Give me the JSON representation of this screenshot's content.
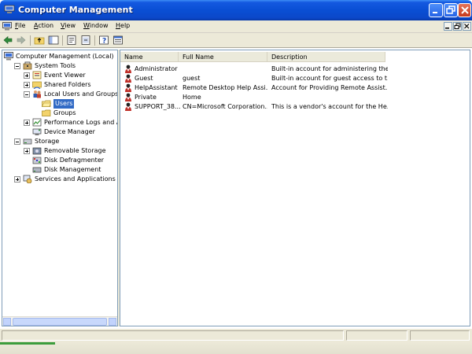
{
  "window": {
    "title": "Computer Management"
  },
  "menu": [
    "File",
    "Action",
    "View",
    "Window",
    "Help"
  ],
  "tree": [
    {
      "label": "Computer Management (Local)",
      "indent": 0,
      "expander": "none",
      "icon": "computer-icon"
    },
    {
      "label": "System Tools",
      "indent": 1,
      "expander": "minus",
      "icon": "tools-icon"
    },
    {
      "label": "Event Viewer",
      "indent": 2,
      "expander": "plus",
      "icon": "event-viewer-icon"
    },
    {
      "label": "Shared Folders",
      "indent": 2,
      "expander": "plus",
      "icon": "shared-folder-icon"
    },
    {
      "label": "Local Users and Groups",
      "indent": 2,
      "expander": "minus",
      "icon": "users-icon"
    },
    {
      "label": "Users",
      "indent": 3,
      "expander": "none",
      "icon": "folder-open-icon",
      "selected": true
    },
    {
      "label": "Groups",
      "indent": 3,
      "expander": "none",
      "icon": "folder-icon"
    },
    {
      "label": "Performance Logs and Alerts",
      "indent": 2,
      "expander": "plus",
      "icon": "performance-icon"
    },
    {
      "label": "Device Manager",
      "indent": 2,
      "expander": "none",
      "icon": "device-manager-icon"
    },
    {
      "label": "Storage",
      "indent": 1,
      "expander": "minus",
      "icon": "storage-icon"
    },
    {
      "label": "Removable Storage",
      "indent": 2,
      "expander": "plus",
      "icon": "removable-storage-icon"
    },
    {
      "label": "Disk Defragmenter",
      "indent": 2,
      "expander": "none",
      "icon": "defrag-icon"
    },
    {
      "label": "Disk Management",
      "indent": 2,
      "expander": "none",
      "icon": "disk-icon"
    },
    {
      "label": "Services and Applications",
      "indent": 1,
      "expander": "plus",
      "icon": "services-icon"
    }
  ],
  "list": {
    "columns": [
      "Name",
      "Full Name",
      "Description"
    ],
    "rows": [
      {
        "name": "Administrator",
        "full_name": "",
        "description": "Built-in account for administering the..."
      },
      {
        "name": "Guest",
        "full_name": "guest",
        "description": "Built-in account for guest access to t..."
      },
      {
        "name": "HelpAssistant",
        "full_name": "Remote Desktop Help Assi...",
        "description": "Account for Providing Remote Assist..."
      },
      {
        "name": "Private",
        "full_name": "Home",
        "description": ""
      },
      {
        "name": "SUPPORT_38...",
        "full_name": "CN=Microsoft Corporation...",
        "description": "This is a vendor's account for the He..."
      }
    ]
  },
  "colors": {
    "title_bar": "#0a4fd4",
    "selection": "#316ac5",
    "face": "#ece9d8"
  }
}
